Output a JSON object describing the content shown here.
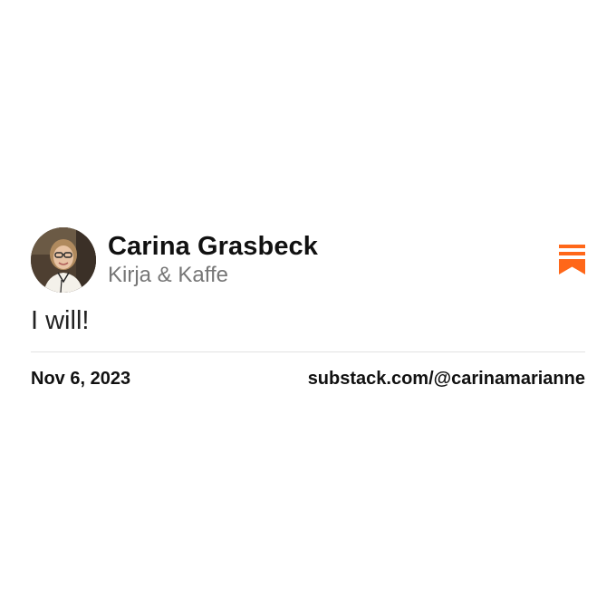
{
  "author": {
    "name": "Carina Grasbeck",
    "publication": "Kirja & Kaffe",
    "avatar_icon": "user-photo-avatar"
  },
  "note": {
    "text": "I will!"
  },
  "footer": {
    "date": "Nov 6, 2023",
    "profile_url": "substack.com/@carinamarianne"
  },
  "brand": {
    "icon": "substack-logo-icon",
    "accent_color": "#FF6719"
  }
}
